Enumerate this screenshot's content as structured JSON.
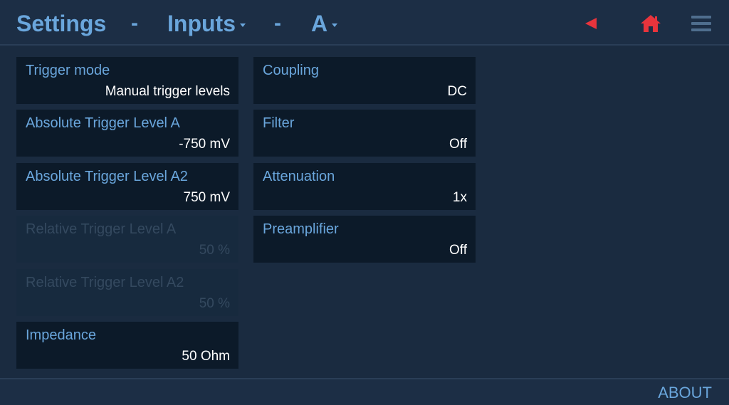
{
  "header": {
    "title": "Settings",
    "separator": "-",
    "section": "Inputs",
    "channel": "A"
  },
  "icons": {
    "back": "back-arrow-icon",
    "home": "home-icon",
    "menu": "hamburger-menu-icon",
    "accent_color": "#e8343c"
  },
  "left_column": [
    {
      "label": "Trigger mode",
      "value": "Manual trigger levels",
      "enabled": true
    },
    {
      "label": "Absolute Trigger Level A",
      "value": "-750 mV",
      "enabled": true
    },
    {
      "label": "Absolute Trigger Level A2",
      "value": "750 mV",
      "enabled": true
    },
    {
      "label": "Relative Trigger Level A",
      "value": "50 %",
      "enabled": false
    },
    {
      "label": "Relative Trigger Level A2",
      "value": "50 %",
      "enabled": false
    },
    {
      "label": "Impedance",
      "value": "50 Ohm",
      "enabled": true
    }
  ],
  "right_column": [
    {
      "label": "Coupling",
      "value": "DC",
      "enabled": true
    },
    {
      "label": "Filter",
      "value": "Off",
      "enabled": true
    },
    {
      "label": "Attenuation",
      "value": "1x",
      "enabled": true
    },
    {
      "label": "Preamplifier",
      "value": "Off",
      "enabled": true
    }
  ],
  "footer": {
    "about_label": "ABOUT"
  }
}
